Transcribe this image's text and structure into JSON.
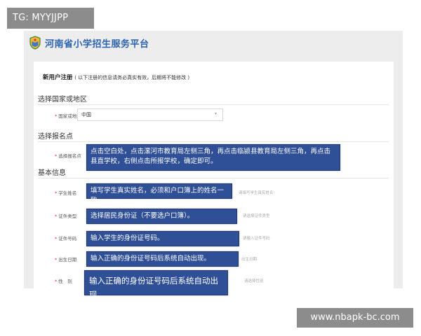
{
  "watermark": {
    "tag": "TG: MYYJJPP",
    "url": "www.nbapk-bc.com"
  },
  "header": {
    "site_title": "河南省小学招生服务平台",
    "logo_icon": "shield-book-logo"
  },
  "form": {
    "title": "新用户注册",
    "note": "( 以下注册的信息请务必真实有效，后期将不能修改 )",
    "sections": {
      "country": "选择国家或地区",
      "school": "选择报名点",
      "basic": "基本信息"
    },
    "fields": {
      "country_label": "国家或地区",
      "country_value": "中国",
      "school_label": "选择报名点",
      "name_label": "学生姓名",
      "name_placeholder": "请填写学生真实姓名",
      "id_type_label": "证件类型",
      "id_type_placeholder": "请选择证件类型",
      "id_number_label": "证件号码",
      "id_number_placeholder": "请输入证件号码",
      "birth_label": "出生日期",
      "birth_placeholder": "出生日期",
      "gender_label": "性　别",
      "gender_placeholder": "请选择性别"
    }
  },
  "tips": {
    "school": "点击空白处，点击漯河市教育局左侧三角，再点击临颍县教育局左侧三角，再点击县直学校，右侧点击所报学校，确定即可。",
    "name": "填写学生真实姓名，必须和户口簿上的姓名一致。",
    "id_type": "选择居民身份证（不要选户口簿）。",
    "id_number": "输入学生的身份证号码。",
    "birth": "输入正确的身份证号码后系统自动出现。",
    "gender": "输入正确的身份证号码后系统自动出现。"
  },
  "colors": {
    "tip_background": "#2f4f96",
    "title_blue": "#2b63b0"
  }
}
